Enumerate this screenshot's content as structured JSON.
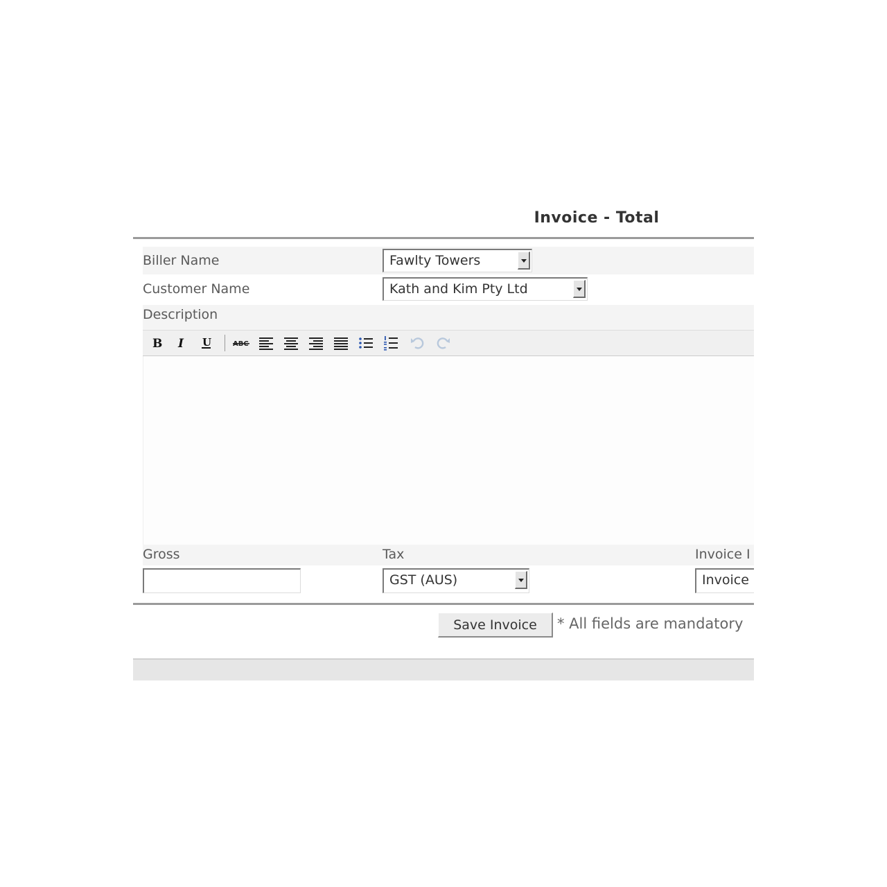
{
  "form": {
    "title": "Invoice - Total",
    "biller_label": "Biller Name",
    "biller_value": "Fawlty Towers",
    "customer_label": "Customer Name",
    "customer_value": "Kath and Kim Pty Ltd",
    "description_label": "Description",
    "gross_label": "Gross",
    "gross_value": "",
    "tax_label": "Tax",
    "tax_value": "GST (AUS)",
    "invoice_label": "Invoice I",
    "invoice_value": "Invoice"
  },
  "toolbar": {
    "buttons": [
      "bold",
      "italic",
      "underline",
      "strikethrough",
      "align-left",
      "align-center",
      "align-right",
      "align-justify",
      "bullet-list",
      "numbered-list",
      "undo",
      "redo"
    ]
  },
  "footer": {
    "save_label": "Save Invoice",
    "mandatory_note": "* All fields are mandatory"
  },
  "colors": {
    "rule": "#9a9a9a",
    "row_background": "#f4f4f4",
    "toolbar_background": "#f0f0f0",
    "disabled_icon": "#b8c8dc"
  }
}
